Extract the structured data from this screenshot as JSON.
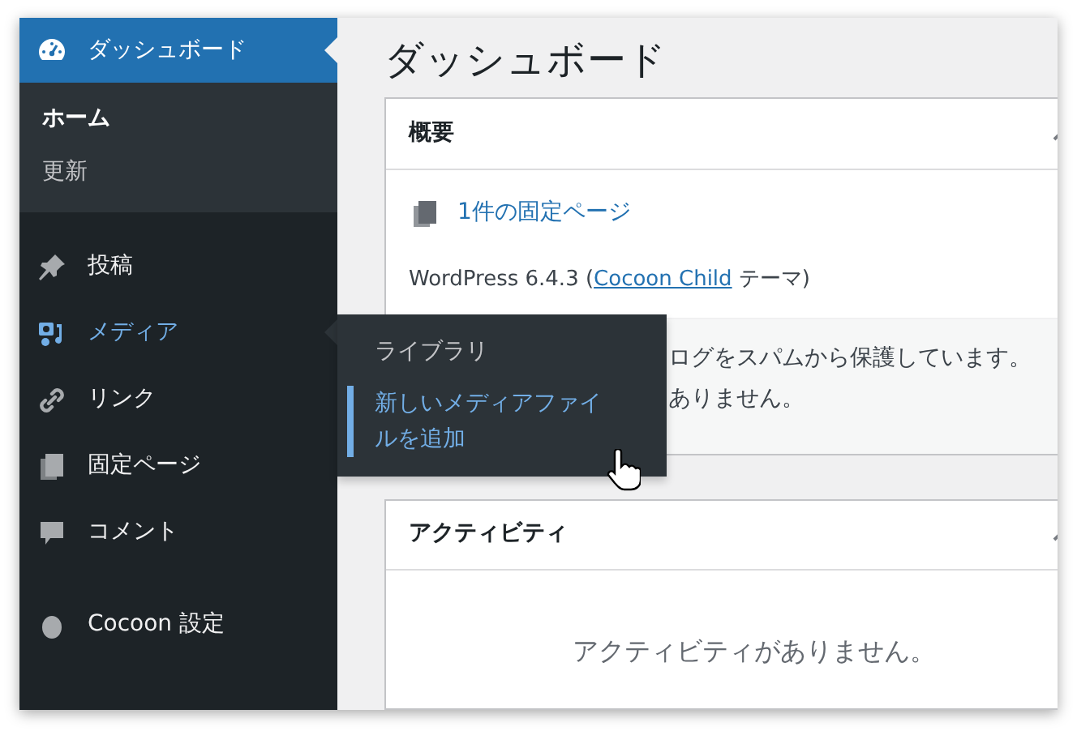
{
  "sidebar": {
    "items": [
      {
        "label": "ダッシュボード",
        "selected": true,
        "hover": false,
        "children": [
          {
            "label": "ホーム",
            "selected": true
          },
          {
            "label": "更新",
            "selected": false
          }
        ]
      },
      {
        "label": "投稿",
        "selected": false,
        "hover": false
      },
      {
        "label": "メディア",
        "selected": false,
        "hover": true,
        "flyout": [
          {
            "label": "ライブラリ",
            "selected": false
          },
          {
            "label": "新しいメディアファイルを追加",
            "selected": true
          }
        ]
      },
      {
        "label": "リンク",
        "selected": false,
        "hover": false
      },
      {
        "label": "固定ページ",
        "selected": false,
        "hover": false
      },
      {
        "label": "コメント",
        "selected": false,
        "hover": false
      },
      {
        "label": "Cocoon 設定",
        "selected": false,
        "hover": false
      }
    ]
  },
  "page_title": "ダッシュボード",
  "panels": [
    {
      "title": "概要",
      "expanded": true,
      "count_link": "1件の固定ページ",
      "version_text": "WordPress 6.4.3 (",
      "theme_link": "Cocoon Child",
      "theme_suffix": " テーマ)",
      "akismet_lines": [
        "ログをスパムから保護しています。",
        "ありません。"
      ]
    },
    {
      "title": "アクティビティ",
      "expanded": true,
      "empty_text": "アクティビティがありません。"
    }
  ]
}
